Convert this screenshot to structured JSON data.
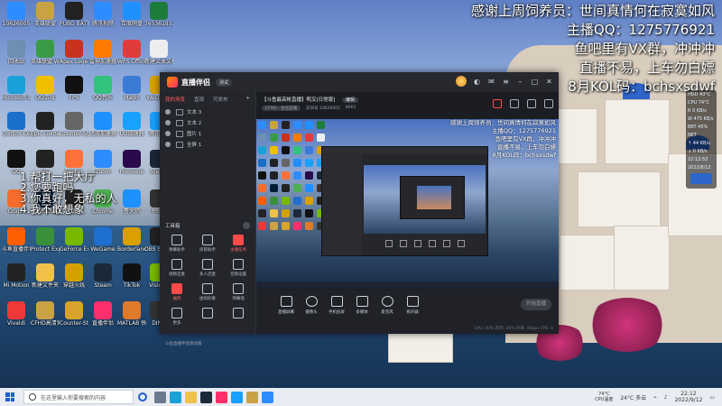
{
  "overlay": {
    "lines": [
      "感谢上周饲养员：世间真情何在寂寞如风",
      "主播QQ：1275776921",
      "鱼吧里有VX群，冲冲冲",
      "直播不易，上车勿白嫖",
      "8月KOL码：bchsxsdwf"
    ]
  },
  "chat": {
    "lines": [
      "1.帮打一把大厅",
      "2.您要跑吗",
      "3.你真好，无私的人",
      "4.我不敢想象"
    ]
  },
  "desktop": {
    "icons": [
      {
        "label": "10626005",
        "color": "#2d8cff"
      },
      {
        "label": "英雄联盟",
        "color": "#c8a245"
      },
      {
        "label": "PUBG BATTLEGR...",
        "color": "#222222"
      },
      {
        "label": "腾讯视频",
        "color": "#2d8cff"
      },
      {
        "label": "百度网盘",
        "color": "#1e90ff"
      },
      {
        "label": "76536193...",
        "color": "#1e7c3a"
      },
      {
        "label": "回收站",
        "color": "#6d8fb3"
      },
      {
        "label": "英雄联盟 WeGame版",
        "color": "#3a9b46"
      },
      {
        "label": "Apex Legends",
        "color": "#c8321f"
      },
      {
        "label": "雷神加速器",
        "color": "#ff7a00"
      },
      {
        "label": "WPS Office",
        "color": "#e23b3b"
      },
      {
        "label": "新建文本文档",
        "color": "#eeeeee"
      },
      {
        "label": "Microsoft Edge",
        "color": "#1aa1d8"
      },
      {
        "label": "QQ游戏",
        "color": "#f0c000"
      },
      {
        "label": "FPS",
        "color": "#111111"
      },
      {
        "label": "QQ音乐",
        "color": "#31c27c"
      },
      {
        "label": "Magic",
        "color": "#3a7bd5"
      },
      {
        "label": "WeGame",
        "color": "#d9a000"
      },
      {
        "label": "Control Center 3.0",
        "color": "#1a70c8"
      },
      {
        "label": "Epic Games Launcher",
        "color": "#222222"
      },
      {
        "label": "Counter-Strike Hunger",
        "color": "#666666"
      },
      {
        "label": "迅游加速器",
        "color": "#1e90ff"
      },
      {
        "label": "UU加速器",
        "color": "#17a2ff"
      },
      {
        "label": "腾讯QQ",
        "color": "#18a0ff"
      },
      {
        "label": "QQ",
        "color": "#111111"
      },
      {
        "label": "UE",
        "color": "#222222"
      },
      {
        "label": "Firefox",
        "color": "#ff7139"
      },
      {
        "label": "Zoom",
        "color": "#2d8cff"
      },
      {
        "label": "Premiere",
        "color": "#2a0a4a"
      },
      {
        "label": "Steam",
        "color": "#1b2838"
      },
      {
        "label": "Origin",
        "color": "#f56c2d"
      },
      {
        "label": "Photoshop",
        "color": "#001e36"
      },
      {
        "label": "DEV",
        "color": "#222222"
      },
      {
        "label": "Chrome",
        "color": "#4caf50"
      },
      {
        "label": "鲁大师",
        "color": "#1e90ff"
      },
      {
        "label": "PREY",
        "color": "#333333"
      },
      {
        "label": "斗鱼直播伴侣",
        "color": "#ff5f00"
      },
      {
        "label": "Protect Experience",
        "color": "#3a8f3a"
      },
      {
        "label": "GeForce Experience",
        "color": "#76b900"
      },
      {
        "label": "WeGame",
        "color": "#1f6fd1"
      },
      {
        "label": "Borderlands",
        "color": "#d9a000"
      },
      {
        "label": "OBS Studio",
        "color": "#222222"
      },
      {
        "label": "Mi Motion",
        "color": "#222222"
      },
      {
        "label": "新建文件夹",
        "color": "#f0c14b"
      },
      {
        "label": "穿越火线",
        "color": "#d4a200"
      },
      {
        "label": "Steam",
        "color": "#1b2838"
      },
      {
        "label": "TikTok",
        "color": "#111111"
      },
      {
        "label": "Vision5",
        "color": "#76b900"
      },
      {
        "label": "Vivaldi",
        "color": "#ef3939"
      },
      {
        "label": "CFHD高清竞技大区",
        "color": "#c8a245"
      },
      {
        "label": "Counter-Strike Global Off...",
        "color": "#d8a32a"
      },
      {
        "label": "直播伴侣",
        "color": "#ff2f6b"
      },
      {
        "label": "MATLAB 快捷方式",
        "color": "#e07a2b"
      },
      {
        "label": "DINO",
        "color": "#333333"
      }
    ]
  },
  "monitor": {
    "blocks": [
      "HDD 40°C",
      "CPU 74°C",
      "R 0 KB/s",
      "W 475 KB/s",
      "BRT 45%",
      "NET",
      "↑ 44 KB/s",
      "↓ 0 KB/s",
      "22:12:52",
      "2022/8/12"
    ]
  },
  "window": {
    "app_name": "直播伴侣",
    "version_badge": "测试",
    "left_tabs": [
      "我的场景",
      "直观",
      "可发布"
    ],
    "scenes": [
      "文本 3",
      "文本 2",
      "图片 1",
      "全屏 1"
    ],
    "tools_header": "工具箱",
    "tools": [
      {
        "label": "弹幕助手",
        "active": false
      },
      {
        "label": "房管助手",
        "active": false
      },
      {
        "label": "主播任务",
        "active": true
      },
      {
        "label": "视频连麦",
        "active": false
      },
      {
        "label": "多人连麦",
        "active": false
      },
      {
        "label": "音频设置",
        "active": false
      },
      {
        "label": "抽奖",
        "active": true
      },
      {
        "label": "虚拟形象",
        "active": false
      },
      {
        "label": "弹幕墙",
        "active": false
      },
      {
        "label": "更多",
        "active": false
      },
      {
        "label": "",
        "active": false
      },
      {
        "label": "",
        "active": false
      }
    ],
    "beta_note": "斗鱼直播伴侣测试版",
    "room_title": "【斗鱼最高帐直播】鸭叉[日常版]",
    "edit_label": "编辑",
    "room_meta": [
      "CFHD - 生化狂潮",
      "房间号 10626005",
      "8062"
    ],
    "preview_overlay": [
      "感谢上周饲养员：世间真情何在寂寞如风",
      "主播QQ：1275776921",
      "鱼吧里有VX群，冲冲冲",
      "直播不易，上车勿白嫖",
      "8月KOL码：bchsxsdwf"
    ],
    "controls": [
      "直播屏幕",
      "摄像头",
      "手机投屏",
      "多媒体",
      "麦克风",
      "扬声器"
    ],
    "start_label": "开始直播",
    "status_text": "CPU: 20%  内存: 45%  码率: 0kbps  FPS: 0"
  },
  "taskbar": {
    "search_placeholder": "在这里输入你要搜索的内容",
    "weather_temp": "74°C",
    "weather_label": "CPU温度",
    "outside": "24°C 多云",
    "time": "22:12",
    "date": "2022/9/12"
  }
}
